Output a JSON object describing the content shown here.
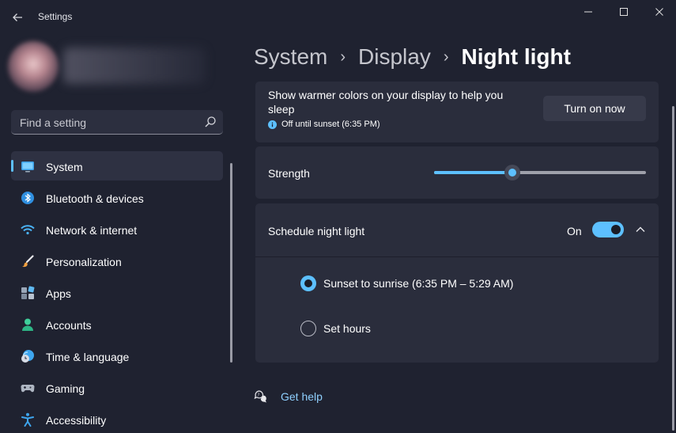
{
  "window": {
    "title": "Settings"
  },
  "sidebar": {
    "search": {
      "placeholder": "Find a setting"
    },
    "items": [
      {
        "label": "System",
        "icon": "monitor-icon",
        "active": true
      },
      {
        "label": "Bluetooth & devices",
        "icon": "bluetooth-icon"
      },
      {
        "label": "Network & internet",
        "icon": "wifi-icon"
      },
      {
        "label": "Personalization",
        "icon": "brush-icon"
      },
      {
        "label": "Apps",
        "icon": "apps-icon"
      },
      {
        "label": "Accounts",
        "icon": "person-icon"
      },
      {
        "label": "Time & language",
        "icon": "clock-globe-icon"
      },
      {
        "label": "Gaming",
        "icon": "gamepad-icon"
      },
      {
        "label": "Accessibility",
        "icon": "accessibility-icon"
      }
    ]
  },
  "header": {
    "breadcrumb": [
      "System",
      "Display",
      "Night light"
    ]
  },
  "night_light": {
    "description_line1": "Show warmer colors on your display to help you",
    "description_line2": "sleep",
    "status": "Off until sunset (6:35 PM)",
    "turn_on_label": "Turn on now"
  },
  "strength": {
    "label": "Strength",
    "value_percent": 37
  },
  "schedule": {
    "label": "Schedule night light",
    "toggle_state": "On",
    "options": [
      {
        "label": "Sunset to sunrise (6:35 PM – 5:29 AM)",
        "selected": true
      },
      {
        "label": "Set hours",
        "selected": false
      }
    ]
  },
  "help": {
    "label": "Get help"
  },
  "colors": {
    "accent": "#5dc0ff",
    "background": "#1f2230",
    "card": "#2a2d3c"
  }
}
